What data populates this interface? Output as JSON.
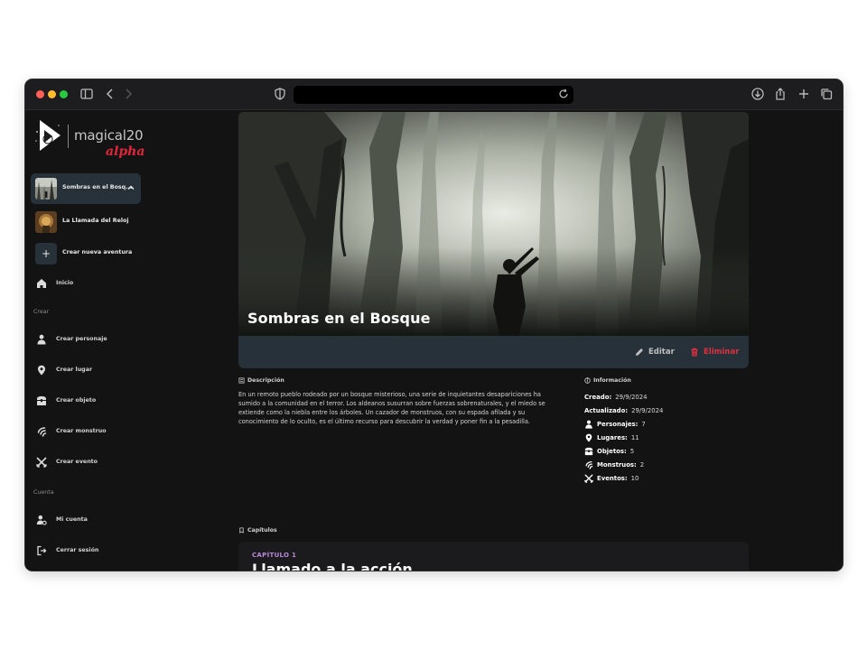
{
  "browser": {
    "url": ""
  },
  "app": {
    "logo_text": "magical20",
    "logo_badge": "alpha"
  },
  "sidebar": {
    "adventures": [
      {
        "label": "Sombras en el Bosq...",
        "active": true
      },
      {
        "label": "La Llamada del Reloj",
        "active": false
      }
    ],
    "new_adventure_label": "Crear nueva aventura",
    "home_label": "Inicio",
    "create_section_label": "Crear",
    "create_items": [
      {
        "label": "Crear personaje",
        "icon": "person-icon"
      },
      {
        "label": "Crear lugar",
        "icon": "map-pin-icon"
      },
      {
        "label": "Crear objeto",
        "icon": "chest-icon"
      },
      {
        "label": "Crear monstruo",
        "icon": "claw-icon"
      },
      {
        "label": "Crear evento",
        "icon": "crossed-swords-icon"
      }
    ],
    "account_section_label": "Cuenta",
    "account_items": [
      {
        "label": "Mi cuenta",
        "icon": "user-cog-icon"
      },
      {
        "label": "Cerrar sesión",
        "icon": "logout-icon"
      }
    ]
  },
  "adventure": {
    "title": "Sombras en el Bosque",
    "edit_label": "Editar",
    "delete_label": "Eliminar",
    "description_heading": "Descripción",
    "description": "En un remoto pueblo rodeado por un bosque misterioso, una serie de inquietantes desapariciones ha sumido a la comunidad en el terror. Los aldeanos susurran sobre fuerzas sobrenaturales, y el miedo se extiende como la niebla entre los árboles. Un cazador de monstruos, con su espada afilada y su conocimiento de lo oculto, es el último recurso para descubrir la verdad y poner fin a la pesadilla.",
    "info_heading": "Información",
    "created_label": "Creado:",
    "created_value": "29/9/2024",
    "updated_label": "Actualizado:",
    "updated_value": "29/9/2024",
    "stats": [
      {
        "label": "Personajes:",
        "value": "7",
        "icon": "person-icon"
      },
      {
        "label": "Lugares:",
        "value": "11",
        "icon": "map-pin-icon"
      },
      {
        "label": "Objetos:",
        "value": "5",
        "icon": "chest-icon"
      },
      {
        "label": "Monstruos:",
        "value": "2",
        "icon": "claw-icon"
      },
      {
        "label": "Eventos:",
        "value": "10",
        "icon": "crossed-swords-icon"
      }
    ],
    "chapters_heading": "Capítulos",
    "chapters": [
      {
        "kicker": "CAPÍTULO 1",
        "title": "Llamado a la acción"
      }
    ]
  },
  "colors": {
    "accent_danger": "#e0303f",
    "accent_chapter": "#b98ad7",
    "panel": "#26313a",
    "background": "#131313"
  }
}
